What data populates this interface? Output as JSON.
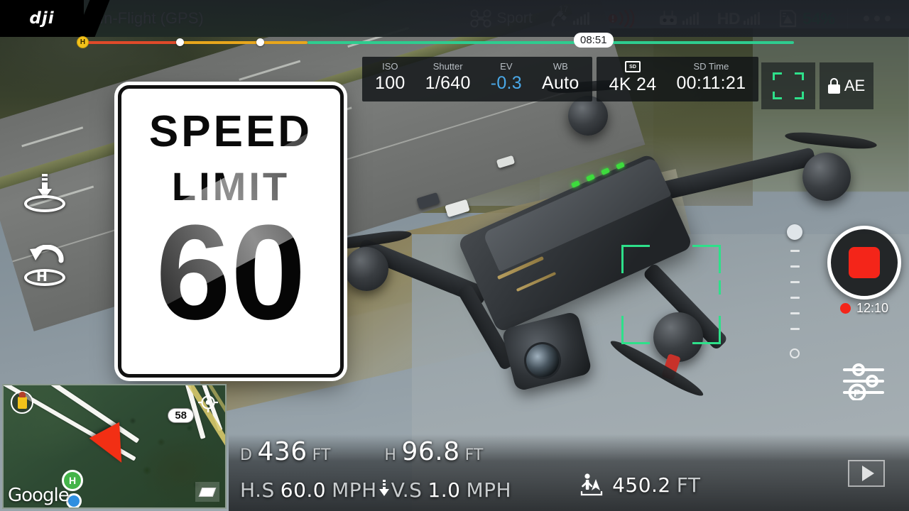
{
  "app": {
    "brand": "dji",
    "flight_status": "In-Flight (GPS)"
  },
  "status_bar": {
    "flight_mode": "Sport",
    "flight_mode_icon": "drone-icon",
    "satellite_icon": "satellite-icon",
    "satellite_count": "17",
    "satellite_signal_bars": 5,
    "transmission_icon": "signal-waves-icon",
    "remote_icon": "remote-controller-icon",
    "remote_signal_bars": 5,
    "hd_label": "HD",
    "hd_signal_bars": 5,
    "battery_icon": "battery-icon",
    "battery_percent": "54%",
    "battery_color": "#2ecc8f",
    "menu_icon": "more-options-icon"
  },
  "timeline": {
    "time_remaining": "08:51",
    "home_marker": "H",
    "colors": {
      "critical": "#e04a2a",
      "warning": "#e8a61c",
      "safe": "#2ecc8f",
      "home": "#f3c21a"
    }
  },
  "camera": {
    "settings": [
      {
        "label": "ISO",
        "value": "100",
        "highlight": false
      },
      {
        "label": "Shutter",
        "value": "1/640",
        "highlight": false
      },
      {
        "label": "EV",
        "value": "-0.3",
        "highlight": true
      },
      {
        "label": "WB",
        "value": "Auto",
        "highlight": false
      }
    ],
    "sd_icon": "sd-card-icon",
    "video_format": "4K 24",
    "sd_time_label": "SD Time",
    "sd_time_value": "00:11:21",
    "focus_icon": "focus-bracket-icon",
    "ae_lock_icon": "lock-icon",
    "ae_label": "AE",
    "focus_color": "#2ee08a"
  },
  "left_controls": [
    {
      "name": "auto-landing-icon",
      "label": "Auto Landing"
    },
    {
      "name": "return-to-home-icon",
      "label": "Return to Home",
      "glyph": "H"
    }
  ],
  "right_controls": {
    "gimbal_slider_name": "gimbal-pitch-slider",
    "record_button_name": "record-stop-button",
    "record_indicator_color": "#f42519",
    "record_time": "12:10",
    "settings_icon": "camera-settings-icon",
    "settings_glyph": "P",
    "playback_icon": "playback-button"
  },
  "overlay_sign": {
    "line1": "SPEED",
    "line2": "LIMIT",
    "number": "60"
  },
  "map": {
    "provider": "Google",
    "route_badge": "58",
    "home_glyph": "H",
    "recenter_icon": "crosshair-icon",
    "clear_icon": "eraser-icon",
    "pin_icon": "pilot-location-icon",
    "aircraft_icon": "aircraft-marker-icon"
  },
  "telemetry": {
    "distance": {
      "key": "D",
      "value": "436",
      "unit": "FT"
    },
    "height": {
      "key": "H",
      "value": "96.8",
      "unit": "FT"
    },
    "horizontal_speed": {
      "key": "H.S",
      "value": "60.0",
      "unit": "MPH"
    },
    "vertical_speed": {
      "key": "V.S",
      "value": "1.0",
      "unit": "MPH",
      "direction_icon": "arrow-down-icon"
    },
    "distance_to_home": {
      "icon": "distance-to-pilot-icon",
      "value": "450.2",
      "unit": "FT"
    }
  }
}
